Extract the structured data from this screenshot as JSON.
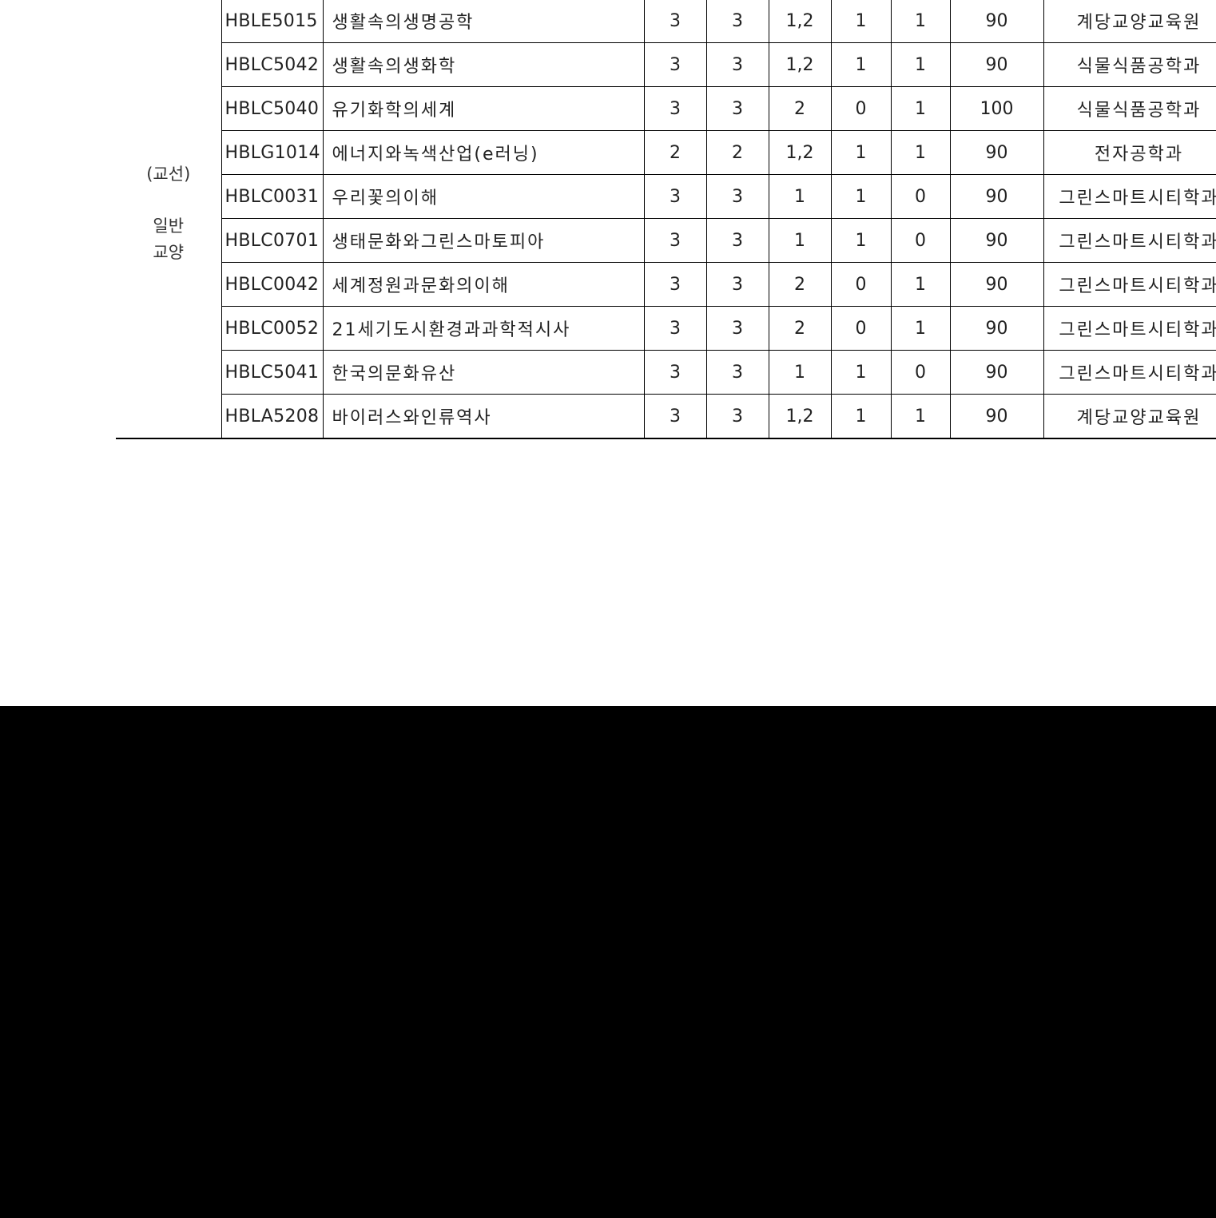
{
  "category": {
    "line1": "(교선)",
    "line2": "일반",
    "line3": "교양"
  },
  "rows": [
    {
      "code": "HBLE5015",
      "name": "생활속의생명공학",
      "c1": "3",
      "c2": "3",
      "c3": "1,2",
      "c4": "1",
      "c5": "1",
      "c6": "90",
      "dept": "계당교양교육원"
    },
    {
      "code": "HBLC5042",
      "name": "생활속의생화학",
      "c1": "3",
      "c2": "3",
      "c3": "1,2",
      "c4": "1",
      "c5": "1",
      "c6": "90",
      "dept": "식물식품공학과"
    },
    {
      "code": "HBLC5040",
      "name": "유기화학의세계",
      "c1": "3",
      "c2": "3",
      "c3": "2",
      "c4": "0",
      "c5": "1",
      "c6": "100",
      "dept": "식물식품공학과"
    },
    {
      "code": "HBLG1014",
      "name": "에너지와녹색산업(e러닝)",
      "c1": "2",
      "c2": "2",
      "c3": "1,2",
      "c4": "1",
      "c5": "1",
      "c6": "90",
      "dept": "전자공학과"
    },
    {
      "code": "HBLC0031",
      "name": "우리꽃의이해",
      "c1": "3",
      "c2": "3",
      "c3": "1",
      "c4": "1",
      "c5": "0",
      "c6": "90",
      "dept": "그린스마트시티학과"
    },
    {
      "code": "HBLC0701",
      "name": "생태문화와그린스마토피아",
      "c1": "3",
      "c2": "3",
      "c3": "1",
      "c4": "1",
      "c5": "0",
      "c6": "90",
      "dept": "그린스마트시티학과"
    },
    {
      "code": "HBLC0042",
      "name": "세계정원과문화의이해",
      "c1": "3",
      "c2": "3",
      "c3": "2",
      "c4": "0",
      "c5": "1",
      "c6": "90",
      "dept": "그린스마트시티학과"
    },
    {
      "code": "HBLC0052",
      "name": "21세기도시환경과과학적시사",
      "c1": "3",
      "c2": "3",
      "c3": "2",
      "c4": "0",
      "c5": "1",
      "c6": "90",
      "dept": "그린스마트시티학과"
    },
    {
      "code": "HBLC5041",
      "name": "한국의문화유산",
      "c1": "3",
      "c2": "3",
      "c3": "1",
      "c4": "1",
      "c5": "0",
      "c6": "90",
      "dept": "그린스마트시티학과"
    },
    {
      "code": "HBLA5208",
      "name": "바이러스와인류역사",
      "c1": "3",
      "c2": "3",
      "c3": "1,2",
      "c4": "1",
      "c5": "1",
      "c6": "90",
      "dept": "계당교양교육원"
    }
  ]
}
